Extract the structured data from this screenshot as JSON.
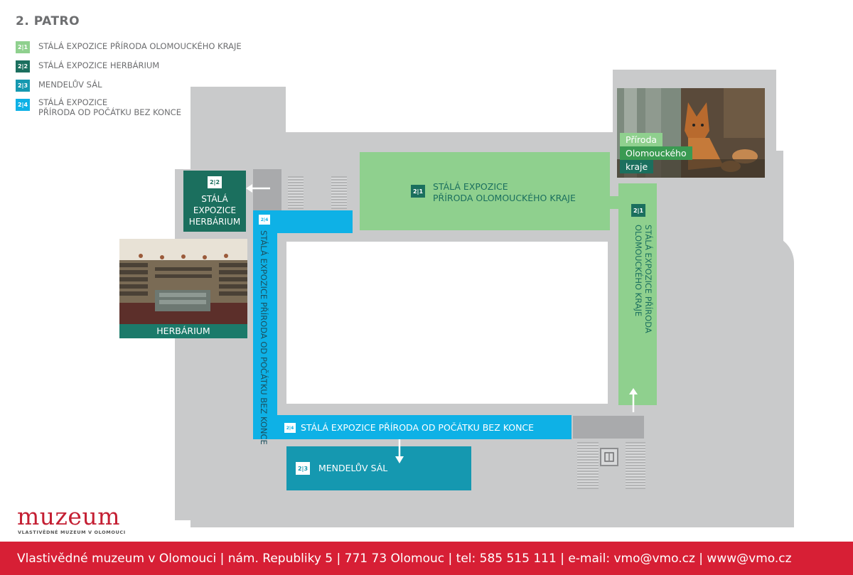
{
  "title": "2. PATRO",
  "colors": {
    "sec_2_1": "#8fd08e",
    "sec_2_2": "#1b6f5e",
    "sec_2_3": "#1598b0",
    "sec_2_4": "#0eb1e6",
    "building": "#c9cacb",
    "footer": "#d71f35"
  },
  "legend": [
    {
      "code": "2|1",
      "text": "STÁLÁ EXPOZICE PŘÍRODA OLOMOUCKÉHO KRAJE"
    },
    {
      "code": "2|2",
      "text": "STÁLÁ EXPOZICE HERBÁRIUM"
    },
    {
      "code": "2|3",
      "text": "MENDELŮV SÁL"
    },
    {
      "code": "2|4",
      "line1": "STÁLÁ EXPOZICE",
      "line2": "PŘÍRODA OD POČÁTKU BEZ KONCE"
    }
  ],
  "rooms": {
    "r21_main": {
      "code": "2|1",
      "line1": "STÁLÁ EXPOZICE",
      "line2": "PŘÍRODA OLOMOUCKÉHO KRAJE"
    },
    "r21_side": {
      "code": "2|1",
      "text": "STÁLÁ EXPOZICE PŘÍRODA OLOMOUCKÉHO KRAJE"
    },
    "r22": {
      "code": "2|2",
      "line1": "STÁLÁ",
      "line2": "EXPOZICE",
      "line3": "HERBÁRIUM"
    },
    "r23": {
      "code": "2|3",
      "text": "MENDELŮV SÁL"
    },
    "r24_vertical": {
      "code": "2|4",
      "text": "STÁLÁ EXPOZICE PŘÍRODA OD POČÁTKU BEZ KONCE"
    },
    "r24_horizontal": {
      "code": "2|4",
      "text": "STÁLÁ EXPOZICE PŘÍRODA OD POČÁTKU BEZ KONCE"
    }
  },
  "photos": {
    "herbarium": {
      "caption": "HERBÁRIUM"
    },
    "fox": {
      "caption1": "Příroda",
      "caption2": "Olomouckého",
      "caption3": "kraje"
    }
  },
  "logo": {
    "name": "muzeum",
    "subtitle": "VLASTIVĚDNÉ MUZEUM V OLOMOUCI"
  },
  "footer": {
    "text": "Vlastivědné muzeum v Olomouci | nám. Republiky 5 | 771 73 Olomouc | tel: 585 515 111 | e-mail: vmo@vmo.cz | www@vmo.cz"
  }
}
